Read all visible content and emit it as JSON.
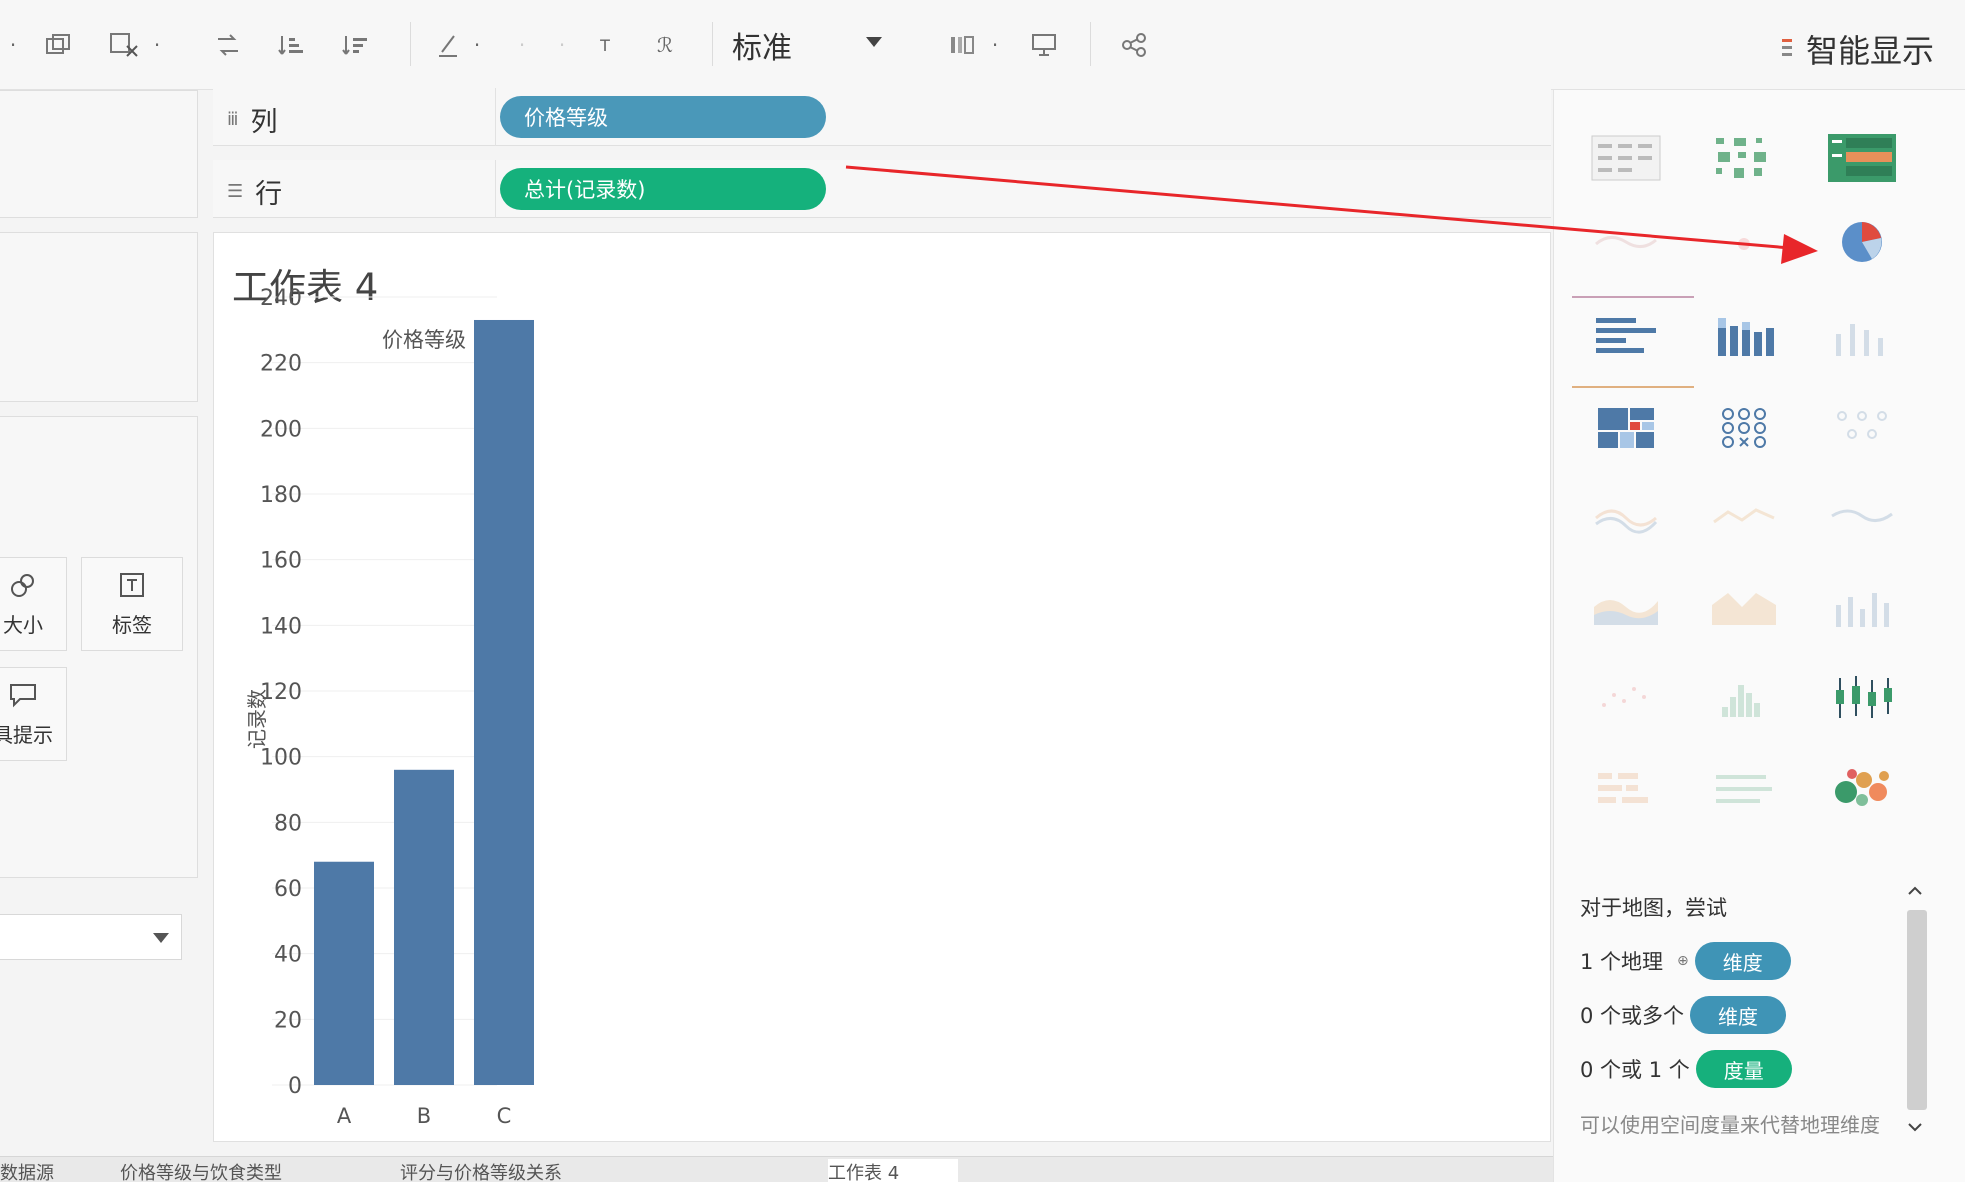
{
  "toolbar": {
    "view_size": "标准",
    "smart_display_label": "智能显示",
    "icons": [
      "chart-icon",
      "clear-sheet-icon",
      "swap-icon",
      "sort-ascending-icon",
      "sort-descending-icon",
      "highlight-icon",
      "labels-icon",
      "pin-icon",
      "fit-icon",
      "presentation-icon",
      "share-icon"
    ]
  },
  "marks_card": {
    "size_label": "大小",
    "label_label": "标签",
    "tooltip_label": "具提示"
  },
  "shelves": {
    "columns": {
      "label": "列",
      "pill": "价格等级"
    },
    "rows": {
      "label": "行",
      "pill": "总计(记录数)"
    }
  },
  "worksheet": {
    "title": "工作表 4"
  },
  "chart_data": {
    "type": "bar",
    "title": "价格等级",
    "xlabel": "",
    "ylabel": "记录数",
    "categories": [
      "A",
      "B",
      "C"
    ],
    "values": [
      68,
      96,
      233
    ],
    "ylim": [
      0,
      240
    ],
    "yticks": [
      0,
      20,
      40,
      60,
      80,
      100,
      120,
      140,
      160,
      180,
      200,
      220,
      240
    ],
    "color": "#4e79a7",
    "grid": true
  },
  "showme": {
    "hint_title": "对于地图，尝试",
    "rows": [
      {
        "prefix": "1 个地理",
        "pill": "维度"
      },
      {
        "prefix": "0 个或多个",
        "pill": "维度"
      },
      {
        "prefix": "0 个或 1 个",
        "pill": "度量"
      }
    ],
    "footnote": "可以使用空间度量来代替地理维度"
  },
  "tabs": [
    "数据源",
    "价格等级与饮食类型",
    "评分与价格等级关系",
    "工作表 4"
  ],
  "colors": {
    "pill_blue": "#4a98b9",
    "pill_green": "#15b17c",
    "bar": "#4e79a7",
    "annotation_arrow": "#e8262a"
  }
}
